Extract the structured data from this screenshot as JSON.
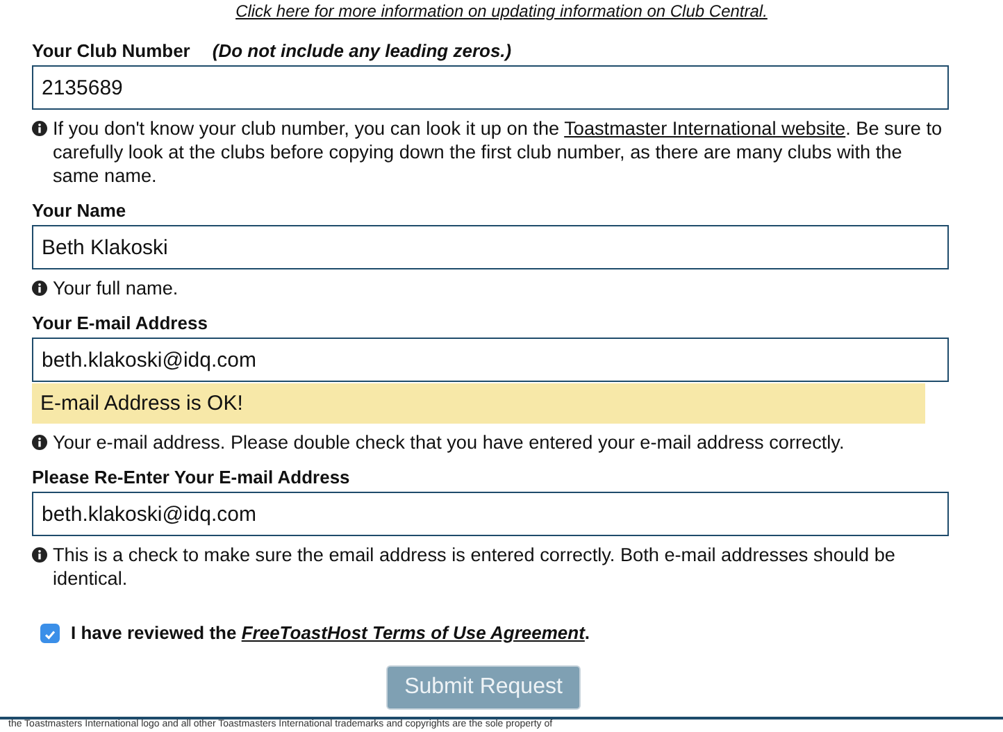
{
  "top_link": "Click here for more information on updating information on Club Central.",
  "fields": [
    {
      "label": "Your Club Number",
      "note": "(Do not include any leading zeros.)",
      "value": "2135689",
      "help": [
        {
          "text": "If you don't know your club number, you can look it up on the "
        },
        {
          "link": "Toastmaster International website"
        },
        {
          "text": ". Be sure to carefully look at the clubs before copying down the first club number, as there are many clubs with the same name."
        }
      ]
    },
    {
      "label": "Your Name",
      "value": "Beth Klakoski",
      "help": [
        {
          "text": "Your full name."
        }
      ]
    },
    {
      "label": "Your E-mail Address",
      "value": "beth.klakoski@idq.com",
      "status": "E-mail Address is OK!",
      "help": [
        {
          "text": "Your e-mail address. Please double check that you have entered your e-mail address correctly."
        }
      ]
    },
    {
      "label": "Please Re-Enter Your E-mail Address",
      "value": "beth.klakoski@idq.com",
      "help": [
        {
          "text": "This is a check to make sure the email address is entered correctly. Both e-mail addresses should be identical."
        }
      ]
    }
  ],
  "agreement": {
    "checked": true,
    "before": "I have reviewed the ",
    "link": "FreeToastHost Terms of Use Agreement",
    "after": "."
  },
  "submit": {
    "label": "Submit Request",
    "disabled": true
  },
  "footer": "the Toastmasters International logo and all other Toastmasters International trademarks and copyrights are the sole property of"
}
